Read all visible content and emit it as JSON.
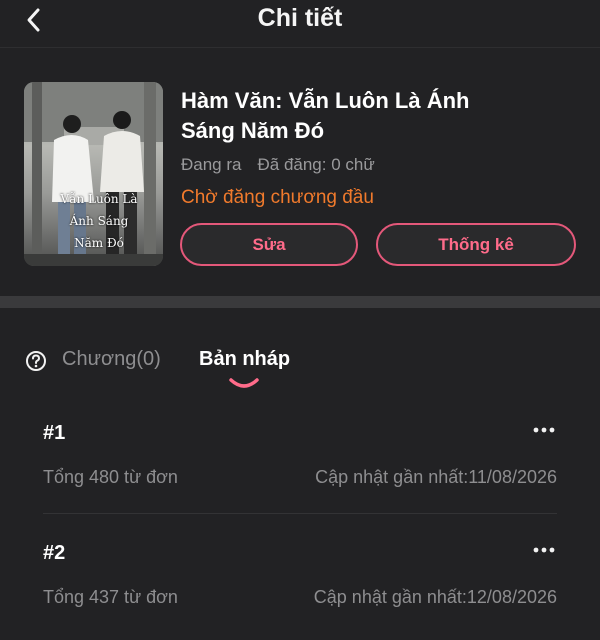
{
  "header": {
    "title": "Chi tiết",
    "back_icon": "chevron-left-icon"
  },
  "book": {
    "cover_text_lines": [
      "Vẫn Luôn Là",
      "Ánh Sáng",
      "Năm Đó"
    ],
    "title": "Hàm Văn: Vẫn Luôn Là Ánh Sáng Năm Đó",
    "status_label": "Đang ra",
    "posted": "Đã đăng: 0 chữ",
    "pending": "Chờ đăng chương đầu",
    "edit_label": "Sửa",
    "stats_label": "Thống kê",
    "accent_color": "#e4587a",
    "pending_color": "#f07a2c"
  },
  "tabs": {
    "help_icon": "question-circle-icon",
    "chapters_label": "Chương(0)",
    "drafts_label": "Bản nháp",
    "active": "drafts"
  },
  "drafts": [
    {
      "number": "#1",
      "words": "Tổng 480 từ đơn",
      "updated": "Cập nhật gần nhất:11/08/2026"
    },
    {
      "number": "#2",
      "words": "Tổng 437 từ đơn",
      "updated": "Cập nhật gần nhất:12/08/2026"
    }
  ]
}
